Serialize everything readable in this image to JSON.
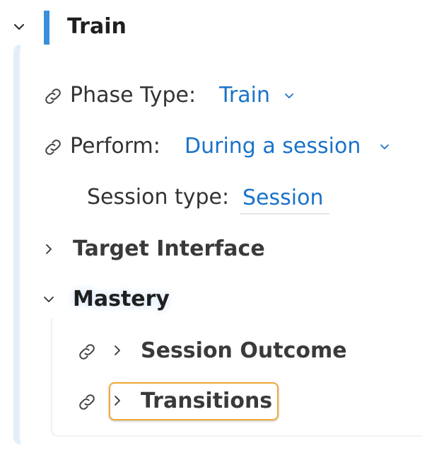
{
  "header": {
    "title": "Train",
    "accent_color": "#3a8fdc",
    "collapse_icon": "chevron-down-icon"
  },
  "fields": {
    "phase_type": {
      "label": "Phase Type:",
      "value": "Train",
      "icon": "link-icon",
      "dropdown_icon": "chevron-down-icon"
    },
    "perform": {
      "label": "Perform:",
      "value": "During a session",
      "icon": "link-icon",
      "dropdown_icon": "chevron-down-icon"
    },
    "session_type": {
      "label": "Session type:",
      "value": "Session"
    }
  },
  "sections": {
    "target_interface": {
      "label": "Target Interface",
      "expand_icon": "chevron-right-icon"
    },
    "mastery": {
      "label": "Mastery",
      "collapse_icon": "chevron-down-icon",
      "items": [
        {
          "label": "Session Outcome",
          "icon": "link-icon",
          "expand_icon": "chevron-right-icon"
        },
        {
          "label": "Transitions",
          "icon": "link-icon",
          "expand_icon": "chevron-right-icon",
          "highlighted": true
        }
      ]
    }
  },
  "colors": {
    "link_blue": "#1a73c9",
    "highlight_orange": "#f0a73a"
  }
}
